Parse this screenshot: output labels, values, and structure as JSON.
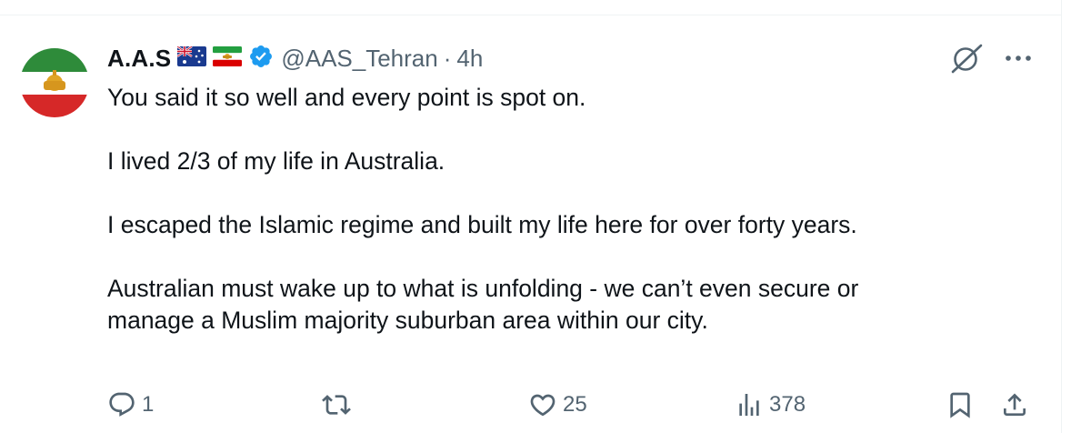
{
  "post": {
    "author": {
      "display_name": "A.A.S",
      "handle": "@AAS_Tehran",
      "separator": "·",
      "time": "4h",
      "flags": [
        "australia-flag",
        "iran-lion-sun-flag"
      ],
      "verified": true
    },
    "body": [
      "You said it so well and every point is spot on.",
      "I lived 2/3 of my life in Australia.",
      "I escaped the Islamic regime and built my life here for over forty years.",
      "Australian must wake up to what is unfolding - we can’t even secure or",
      "manage a Muslim majority suburban area within our city."
    ],
    "actions": {
      "reply_count": "1",
      "repost_count": "",
      "like_count": "25",
      "views_count": "378"
    }
  },
  "colors": {
    "text": "#0f1419",
    "secondary": "#536471",
    "verified": "#1d9bf0",
    "divider": "#eff3f4"
  },
  "icons": [
    "grok-icon",
    "more-icon",
    "reply-icon",
    "repost-icon",
    "like-icon",
    "views-icon",
    "bookmark-icon",
    "share-icon"
  ]
}
